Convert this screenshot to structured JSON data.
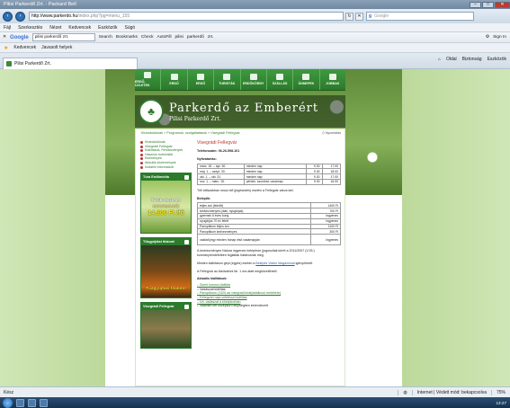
{
  "window": {
    "title": "Pilisi Parkerdő Zrt. - Packard Bell",
    "controls": [
      "–",
      "□",
      "✕"
    ]
  },
  "address": {
    "url_domain": "http://www.parkerdo.hu",
    "url_path": "/index.php?pg=menu_155",
    "search_placeholder": "Google"
  },
  "menubar": {
    "items": [
      "Fájl",
      "Szerkesztés",
      "Nézet",
      "Kedvencek",
      "Eszközök",
      "Súgó"
    ]
  },
  "google_toolbar": {
    "logo": "Google",
    "query": "pilisi parkerdő zrt.",
    "items": [
      "Search",
      "Bookmarks",
      "Check",
      "AutoFill",
      "pilisi",
      "parkerdő",
      "zrt."
    ],
    "signin": "Sign In"
  },
  "favorites": {
    "label": "Kedvencek",
    "link": "Javasolt helyek"
  },
  "tab": {
    "title": "Pilisi Parkerdő Zrt.",
    "tools": [
      "Oldal",
      "Biztonság",
      "Eszközök"
    ]
  },
  "site": {
    "nav": [
      "ERDŐ, ÜZLETEK",
      "ERDŐ",
      "ERDŐ",
      "TURISTÁK",
      "ERDŐKÖRNY",
      "SZÁLLÁS",
      "ÜNNEPEK",
      "JOBBAK"
    ],
    "logo_title": "Parkerdő az Emberért",
    "logo_subtitle": "Pilisi Parkerdő Zrt.",
    "breadcrumb": [
      "Kirándulóknak",
      "Programok, szolgáltatások",
      "Visegrádi Fellegvár"
    ],
    "crumb_tools": "Nyomtatás",
    "sidemenu": [
      "Kirándulóknak",
      "Visegrádi Fellegvár",
      "Kiállítások, Rendezvények",
      "Hasznos tudnivalók",
      "Események",
      "Aktuális közlemények",
      "Irodalmi információk"
    ],
    "box1": {
      "title": "Túra Erdőmédia",
      "line1": "Túrák részletes",
      "line2": "INFORMÁCIÓI",
      "line3": "14.500 Ft /fő"
    },
    "box2": {
      "title": "Tűzgyújtási tilalom!",
      "line1": "Tűzgyújtási tilalom!"
    },
    "box3": {
      "title": "Visegrádi Fellegvár"
    },
    "heading": "Visegrádi Fellegvár",
    "phone": "Telefonszám: 06-26-598-101",
    "hours_title": "Nyitvatartás:",
    "hours": [
      {
        "period": "márc. 15. – ápr. 30.",
        "days": "minden nap",
        "open": "9.30",
        "close": "17.00"
      },
      {
        "period": "máj. 1. – szept. 30.",
        "days": "minden nap",
        "open": "9.30",
        "close": "18.00"
      },
      {
        "period": "okt. 1. – okt. 31.",
        "days": "minden nap",
        "open": "9.30",
        "close": "17.00"
      },
      {
        "period": "nov. 1. – márc. 15.",
        "days": "péntek, szombat, vasárnap",
        "open": "9.30",
        "close": "16.00"
      }
    ],
    "note": "Téli időszakban rossz idő (jegesedés) esetén a Fellegvár zárva tart.",
    "prices_title": "Belépők:",
    "prices": [
      {
        "label": "teljes árú (felnőtt)",
        "value": "1400 Ft"
      },
      {
        "label": "kedvezményes (diák, nyugdíjas)",
        "value": "700 Ft"
      },
      {
        "label": "gyermek 6 éves korig",
        "value": "ingyenes"
      },
      {
        "label": "nyugdíjas 70 év felett",
        "value": "ingyenes"
      },
      {
        "label": "Panoptikum teljes árú",
        "value": "1100 Ft"
      },
      {
        "label": "Panoptikum kedvezményes",
        "value": "300 Ft"
      },
      {
        "label": "családi jegy minden hónap első vasárnapján",
        "value": "ingyenes"
      }
    ],
    "p1": "A kedvezményes Natura ingyenes belépésre (jogosultak körét a 2011/2007 (V.25.) kormányrendeletben foglaltak határozzák meg.",
    "p2": "Minden kiállításon gépi (egyes) esetén a",
    "p2_link": "Belépés Visitor Magazinnál",
    "p2_end": "igényelhető.",
    "p3": "A Fellegvár az Alsóvárból kb. 1 óra alatt megközelíthető.",
    "exhibits_title": "Aktuális kiállítások:",
    "exhibits": [
      "Szent korona kiállítás",
      "Vadászati kiállítás",
      "Panoptikum (1320-as visegrádi királytalálkozó emlékére)",
      "Fellegvári napi vetítéssel kiállítás",
      "Ún. vadászat a középkorban",
      "valamint két középkori helyiségben berendezett"
    ]
  },
  "status": {
    "left": "Kész",
    "zone": "Internet | Védett mód: bekapcsolva",
    "zoom": "75%"
  },
  "taskbar": {
    "time": "13:27"
  }
}
